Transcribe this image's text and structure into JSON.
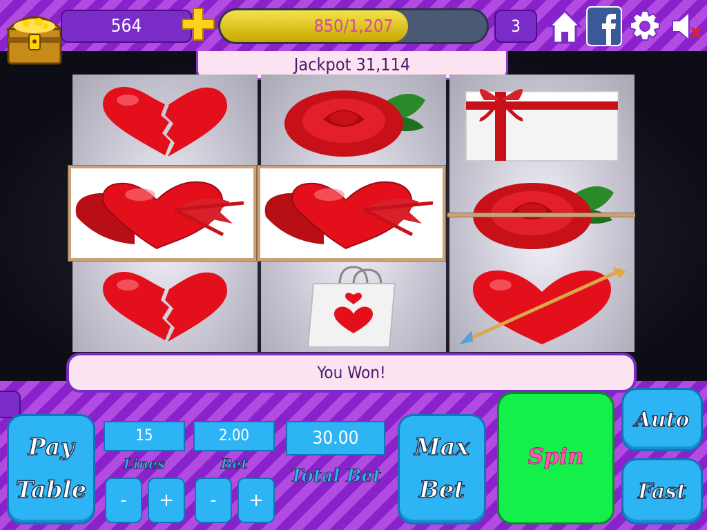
{
  "header": {
    "coins": "564",
    "xp_text": "850/1,207",
    "xp_progress": 0.704,
    "level": "3"
  },
  "jackpot": "Jackpot 31,114",
  "message": "You Won!",
  "reels": [
    [
      "broken-heart",
      "heart-box",
      "broken-heart"
    ],
    [
      "red-rose",
      "heart-box",
      "shopping-bag"
    ],
    [
      "gift-box",
      "red-rose",
      "arrow-heart"
    ]
  ],
  "winning_line": "middle row",
  "controls": {
    "pay_table_label": "Pay Table",
    "lines_value": "15",
    "lines_label": "Lines",
    "bet_value": "2.00",
    "bet_label": "Bet",
    "total_bet_value": "30.00",
    "total_bet_label": "Total Bet",
    "max_bet_label": "Max Bet",
    "spin_label": "Spin",
    "auto_label": "Auto",
    "fast_label": "Fast",
    "minus": "-",
    "plus": "+"
  },
  "icons": [
    "treasure-chest-icon",
    "plus-icon",
    "home-icon",
    "facebook-icon",
    "gear-icon",
    "mute-icon"
  ],
  "colors": {
    "purple": "#9a34d6",
    "button_blue": "#2db4f4",
    "spin_green": "#14f04a",
    "spin_text_pink": "#ff5ab0",
    "xp_yellow": "#f5e24a"
  }
}
